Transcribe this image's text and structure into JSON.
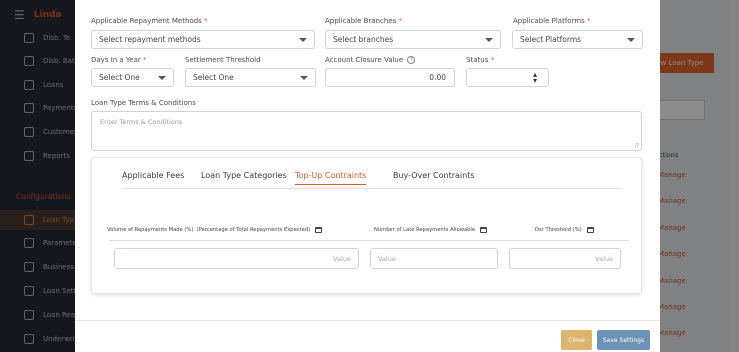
{
  "app": {
    "brand": "Linda"
  },
  "background": {
    "nav_items": [
      {
        "label": "Disb. Te",
        "icon": "disbursement-icon"
      },
      {
        "label": "Disb. Bat",
        "icon": "document-icon"
      },
      {
        "label": "Loans",
        "icon": "hand-coin-icon"
      },
      {
        "label": "Payments",
        "icon": "bell-icon"
      },
      {
        "label": "Customer",
        "icon": "user-icon"
      },
      {
        "label": "Reports",
        "icon": "chart-icon"
      }
    ],
    "config_section": "Configurations",
    "config_items": [
      {
        "label": "Loan Typ",
        "icon": "document-icon",
        "active": true
      },
      {
        "label": "Paramete",
        "icon": "hand-coin-icon"
      },
      {
        "label": "Business",
        "icon": "calendar-icon"
      },
      {
        "label": "Loan Sett",
        "icon": "gear-icon"
      },
      {
        "label": "Loan Rea",
        "icon": "info-icon"
      },
      {
        "label": "Underwri",
        "icon": "id-card-icon"
      }
    ],
    "new_loan_button": "w Loan Type",
    "actions_header": "ctions",
    "manage_links": [
      "Manage",
      "Manage",
      "Manage",
      "Manage",
      "Manage",
      "Manage",
      "Manage"
    ]
  },
  "form": {
    "repayment_methods": {
      "label": "Applicable Repayment Methods",
      "required": "*",
      "value": "Select repayment methods"
    },
    "branches": {
      "label": "Applicable Branches",
      "required": "*",
      "value": "Select branches"
    },
    "platforms": {
      "label": "Applicable Platforms",
      "required": "*",
      "value": "Select Platforms"
    },
    "days_in_year": {
      "label": "Days In a Year",
      "required": "*",
      "value": "Select One"
    },
    "settlement_threshold": {
      "label": "Settlement Threshold",
      "value": "Select One"
    },
    "account_closure": {
      "label": "Account Closure Value",
      "value": "0.00"
    },
    "status": {
      "label": "Status",
      "required": "*",
      "value": ""
    },
    "terms": {
      "label": "Loan Type Terms & Conditions",
      "placeholder": "Enter Terms & Conditions"
    }
  },
  "tabs": [
    {
      "label": "Applicable Fees",
      "active": false
    },
    {
      "label": "Loan Type Categories",
      "active": false
    },
    {
      "label": "Top-Up Contraints",
      "active": true
    },
    {
      "label": "Buy-Over Contraints",
      "active": false
    }
  ],
  "topup": {
    "columns": [
      "Volume of Repayments Made (%). (Percentage of Total Repayments Expected)",
      "Number of Late Repayments Allowable",
      "Dsr Threshold (%)"
    ],
    "placeholders": [
      "Value",
      "Value",
      "Value"
    ]
  },
  "footer": {
    "close": "Close",
    "save": "Save Settings"
  },
  "colors": {
    "accent": "#e15a25",
    "close_btn": "#dcb56e",
    "save_btn": "#6c92b5"
  }
}
